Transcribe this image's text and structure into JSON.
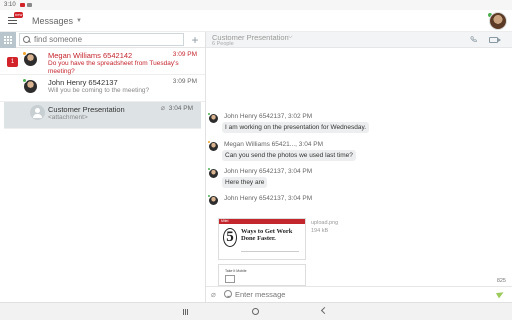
{
  "status_bar": {
    "time": "3:10"
  },
  "header": {
    "menu_badge": "new",
    "title": "Messages"
  },
  "search": {
    "placeholder": "find someone",
    "add_label": "+"
  },
  "conversations": [
    {
      "name": "Megan Williams 6542142",
      "time": "3:09 PM",
      "preview": "Do you have the spreadsheet from Tuesday's meeting?",
      "unread": "1",
      "status": "away"
    },
    {
      "name": "John Henry 6542137",
      "time": "3:09 PM",
      "preview": "Will you be coming to the meeting?",
      "status": "online"
    },
    {
      "name": "Customer Presentation",
      "time": "3:04 PM",
      "preview": "<attachment>",
      "type": "group"
    }
  ],
  "conversation": {
    "title": "Customer Presentation",
    "subtitle": "6 People",
    "messages": [
      {
        "sender": "John Henry 6542137, 3:02 PM",
        "text": "I am working on the presentation for Wednesday.",
        "status": "online"
      },
      {
        "sender": "Megan Williams 65421..., 3:04 PM",
        "text": "Can you send the photos we used last time?",
        "status": "away"
      },
      {
        "sender": "John Henry 6542137, 3:04 PM",
        "text": "Here they are",
        "status": "online"
      },
      {
        "sender": "John Henry 6542137, 3:04 PM",
        "status": "online"
      }
    ],
    "attachment": {
      "brand": "Mitel",
      "number": "5",
      "headline": "Ways to Get Work Done Faster.",
      "filename": "upload.png",
      "size": "194 kB",
      "second_title": "Take It Mobile"
    }
  },
  "composer": {
    "placeholder": "Enter message",
    "char_count": "825"
  },
  "colors": {
    "accent_red": "#d2232a",
    "online_green": "#4caf50",
    "away_orange": "#f0a22a",
    "send_green": "#9ccb5b"
  }
}
